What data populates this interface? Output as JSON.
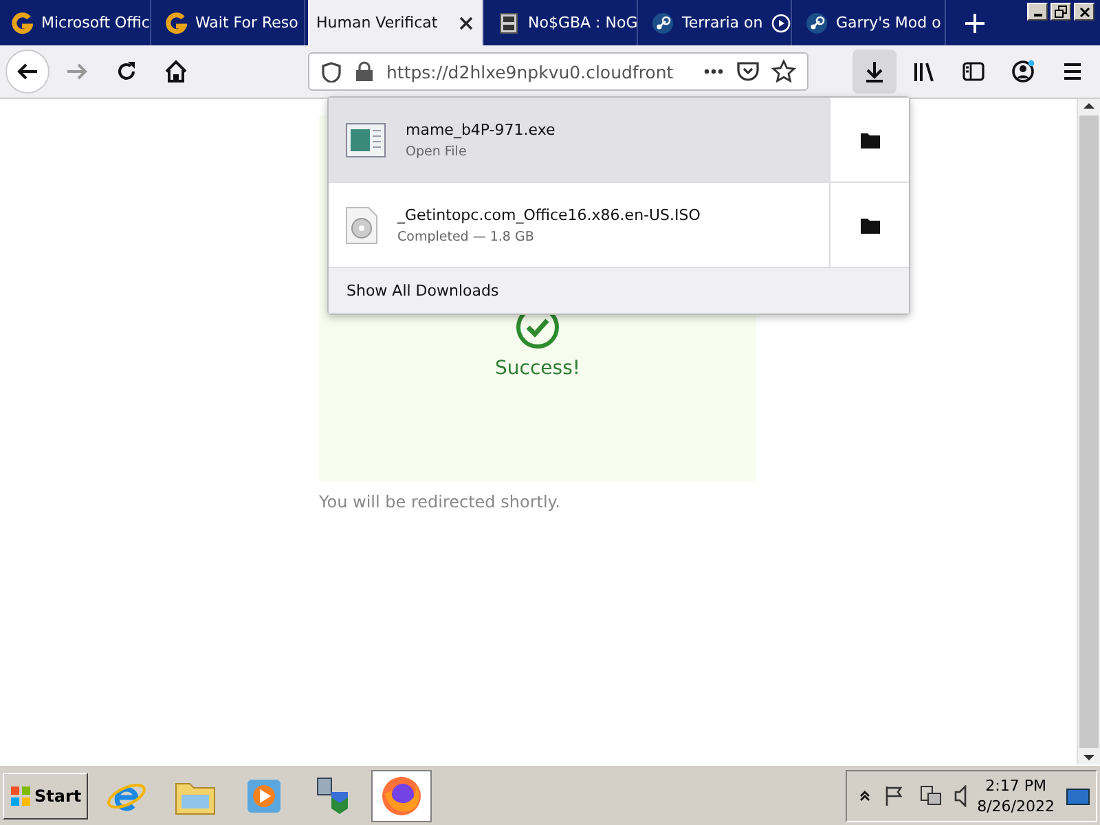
{
  "tabs": [
    {
      "label": "Microsoft Offic",
      "kind": "g",
      "selected": false,
      "playing": false
    },
    {
      "label": "Wait For Reso",
      "kind": "g",
      "selected": false,
      "playing": false
    },
    {
      "label": "Human Verificat",
      "kind": "plain",
      "selected": true,
      "playing": false
    },
    {
      "label": "No$GBA : NoG",
      "kind": "ds",
      "selected": false,
      "playing": false
    },
    {
      "label": "Terraria on",
      "kind": "steam",
      "selected": false,
      "playing": true
    },
    {
      "label": "Garry's Mod o",
      "kind": "steam",
      "selected": false,
      "playing": false
    }
  ],
  "address_bar": {
    "url": "https://d2hlxe9npkvu0.cloudfront"
  },
  "downloads": {
    "items": [
      {
        "name": "mame_b4P-971.exe",
        "status": "Open File",
        "kind": "exe",
        "selected": true
      },
      {
        "name": "_Getintopc.com_Office16.x86.en-US.ISO",
        "status": "Completed — 1.8 GB",
        "kind": "disc",
        "selected": false
      }
    ],
    "footer": "Show All Downloads"
  },
  "page": {
    "status": "Success!",
    "note": "You will be redirected shortly."
  },
  "taskbar": {
    "start": "Start",
    "apps": [
      {
        "kind": "ie",
        "active": false
      },
      {
        "kind": "folder",
        "active": false
      },
      {
        "kind": "media",
        "active": false
      },
      {
        "kind": "network",
        "active": false
      },
      {
        "kind": "firefox",
        "active": true
      }
    ],
    "time": "2:17 PM",
    "date": "8/26/2022"
  }
}
